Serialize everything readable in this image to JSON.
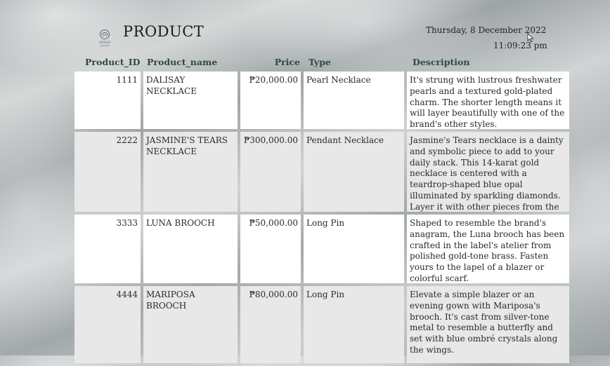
{
  "header": {
    "logo_text": "HIYAS",
    "title": "PRODUCT",
    "date": "Thursday, 8 December 2022",
    "time": "11:09:23 pm"
  },
  "columns": {
    "id": "Product_ID",
    "name": "Product_name",
    "price": "Price",
    "type": "Type",
    "description": "Description"
  },
  "rows": [
    {
      "id": "1111",
      "name": "DALISAY NECKLACE",
      "price": "₱20,000.00",
      "type": "Pearl Necklace",
      "description": "It's strung with lustrous freshwater pearls and a textured gold-plated charm. The shorter length means it will layer beautifully with one of the brand's other styles."
    },
    {
      "id": "2222",
      "name": "JASMINE'S TEARS NECKLACE",
      "price": "₱300,000.00",
      "type": "Pendant Necklace",
      "description": "Jasmine's Tears necklace is a dainty and symbolic piece to add to your daily stack. This 14-karat gold necklace is centered with a teardrop-shaped blue opal illuminated by sparkling diamonds. Layer it with other pieces from the brand."
    },
    {
      "id": "3333",
      "name": "LUNA BROOCH",
      "price": "₱50,000.00",
      "type": "Long Pin",
      "description": "Shaped to resemble the brand's anagram, the Luna brooch has been crafted in the label's atelier from polished gold-tone brass. Fasten yours to the lapel of a blazer or colorful scarf."
    },
    {
      "id": "4444",
      "name": "MARIPOSA BROOCH",
      "price": "₱80,000.00",
      "type": "Long Pin",
      "description": "Elevate a simple blazer or an evening gown with Mariposa's brooch. It's cast from silver-tone metal to resemble a butterfly and set with blue ombré crystals along the wings."
    }
  ]
}
